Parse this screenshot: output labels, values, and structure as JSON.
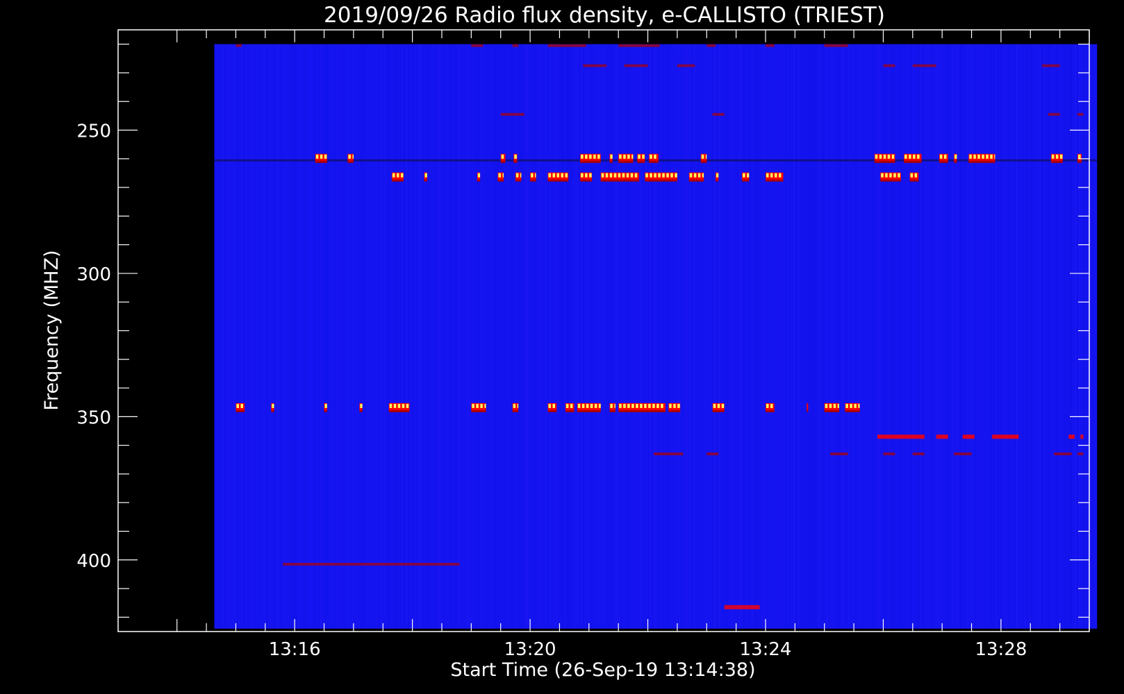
{
  "chart_data": {
    "type": "heatmap",
    "title": "2019/09/26  Radio flux density, e-CALLISTO (TRIEST)",
    "xlabel": "Start Time (26-Sep-19 13:14:38)",
    "ylabel": "Frequency (MHZ)",
    "x_range_minutes": [
      13.0,
      29.5
    ],
    "y_range_mhz": [
      215,
      425
    ],
    "y_inverted": true,
    "data_extent": {
      "x_start": "13:14:38",
      "x_end": "13:29:38",
      "y_top_mhz": 220,
      "y_bottom_mhz": 424
    },
    "x_ticks": [
      "13:16",
      "13:20",
      "13:24",
      "13:28"
    ],
    "x_tick_minutes": [
      16,
      20,
      24,
      28
    ],
    "y_ticks": [
      250,
      300,
      350,
      400
    ],
    "colormap": [
      "#0000ff",
      "#b00000",
      "#ff0000",
      "#ffd700",
      "#ffff60"
    ],
    "background_color": "#1414f0",
    "bursts": [
      {
        "freq": 259.5,
        "segments": [
          [
            16.35,
            16.55
          ],
          [
            16.9,
            17.0
          ],
          [
            19.5,
            19.58
          ],
          [
            19.72,
            19.78
          ],
          [
            20.85,
            21.2
          ],
          [
            21.35,
            21.4
          ],
          [
            21.5,
            21.75
          ],
          [
            21.82,
            21.95
          ],
          [
            22.02,
            22.18
          ],
          [
            22.9,
            23.0
          ],
          [
            25.85,
            26.2
          ],
          [
            26.35,
            26.65
          ],
          [
            26.95,
            27.1
          ],
          [
            27.2,
            27.25
          ],
          [
            27.45,
            27.9
          ],
          [
            28.85,
            29.05
          ],
          [
            29.3,
            29.37
          ]
        ],
        "intensity": 1.0
      },
      {
        "freq": 266,
        "segments": [
          [
            17.65,
            17.85
          ],
          [
            18.2,
            18.25
          ],
          [
            19.1,
            19.15
          ],
          [
            19.45,
            19.55
          ],
          [
            19.75,
            19.85
          ],
          [
            20.0,
            20.1
          ],
          [
            20.3,
            20.65
          ],
          [
            20.85,
            21.05
          ],
          [
            21.2,
            21.85
          ],
          [
            21.95,
            22.5
          ],
          [
            22.7,
            22.95
          ],
          [
            23.15,
            23.2
          ],
          [
            23.6,
            23.72
          ],
          [
            24.0,
            24.3
          ],
          [
            25.95,
            26.3
          ],
          [
            26.45,
            26.6
          ]
        ],
        "intensity": 0.9
      },
      {
        "freq": 346.5,
        "segments": [
          [
            15.0,
            15.15
          ],
          [
            15.6,
            15.65
          ],
          [
            16.5,
            16.55
          ],
          [
            17.1,
            17.15
          ],
          [
            17.6,
            17.95
          ],
          [
            19.0,
            19.25
          ],
          [
            19.7,
            19.8
          ],
          [
            20.3,
            20.45
          ],
          [
            20.6,
            20.75
          ],
          [
            20.8,
            21.2
          ],
          [
            21.35,
            21.45
          ],
          [
            21.5,
            22.3
          ],
          [
            22.35,
            22.55
          ],
          [
            23.1,
            23.3
          ],
          [
            24.0,
            24.15
          ],
          [
            24.7,
            24.72
          ],
          [
            25.0,
            25.25
          ],
          [
            25.35,
            25.6
          ]
        ],
        "intensity": 0.95
      },
      {
        "freq": 357,
        "segments": [
          [
            25.9,
            26.7
          ],
          [
            26.9,
            27.1
          ],
          [
            27.35,
            27.55
          ],
          [
            27.85,
            28.3
          ],
          [
            29.15,
            29.25
          ],
          [
            29.35,
            29.4
          ]
        ],
        "intensity": 0.7
      },
      {
        "freq": 363,
        "segments": [
          [
            22.1,
            22.6
          ],
          [
            23.0,
            23.2
          ],
          [
            25.1,
            25.4
          ],
          [
            26.0,
            26.2
          ],
          [
            26.5,
            26.7
          ],
          [
            27.2,
            27.5
          ],
          [
            28.9,
            29.2
          ],
          [
            29.3,
            29.4
          ]
        ],
        "intensity": 0.45
      },
      {
        "freq": 220.5,
        "segments": [
          [
            15.0,
            15.1
          ],
          [
            19.0,
            19.2
          ],
          [
            19.7,
            19.8
          ],
          [
            20.3,
            20.95
          ],
          [
            21.5,
            22.2
          ],
          [
            23.0,
            23.15
          ],
          [
            24.0,
            24.15
          ],
          [
            25.0,
            25.4
          ]
        ],
        "intensity": 0.45
      },
      {
        "freq": 227.5,
        "segments": [
          [
            20.9,
            21.3
          ],
          [
            21.6,
            22.0
          ],
          [
            22.5,
            22.8
          ],
          [
            26.0,
            26.2
          ],
          [
            26.5,
            26.9
          ],
          [
            28.7,
            29.0
          ]
        ],
        "intensity": 0.35
      },
      {
        "freq": 244.5,
        "segments": [
          [
            19.5,
            19.9
          ],
          [
            23.1,
            23.3
          ],
          [
            28.8,
            29.0
          ],
          [
            29.3,
            29.4
          ]
        ],
        "intensity": 0.4
      },
      {
        "freq": 401.5,
        "segments": [
          [
            15.8,
            18.8
          ]
        ],
        "intensity": 0.4
      },
      {
        "freq": 416.5,
        "segments": [
          [
            23.3,
            23.9
          ]
        ],
        "intensity": 0.6
      }
    ]
  }
}
